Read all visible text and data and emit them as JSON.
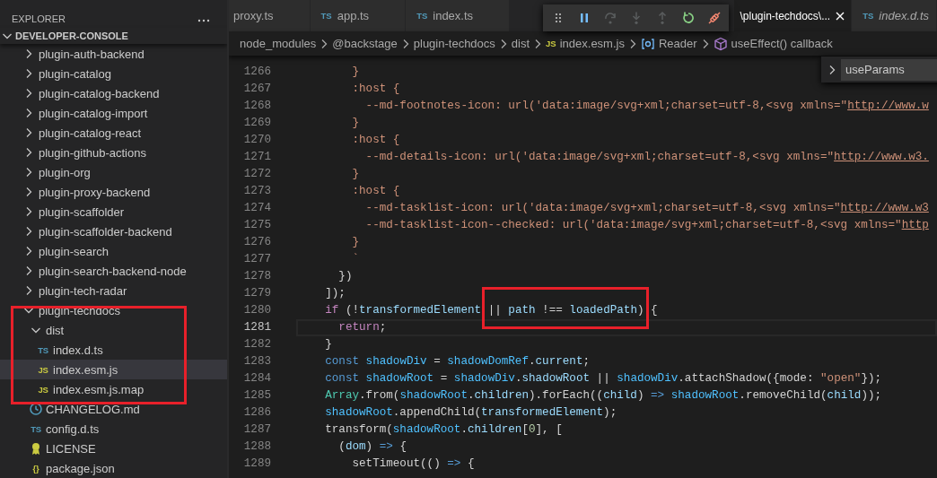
{
  "sidebar": {
    "title": "EXPLORER",
    "section": {
      "label": "DEVELOPER-CONSOLE",
      "expanded": true
    },
    "tree": [
      {
        "label": "plugin-auth-backend",
        "kind": "folder",
        "expanded": false,
        "selected": false
      },
      {
        "label": "plugin-catalog",
        "kind": "folder",
        "expanded": false,
        "selected": false
      },
      {
        "label": "plugin-catalog-backend",
        "kind": "folder",
        "expanded": false,
        "selected": false
      },
      {
        "label": "plugin-catalog-import",
        "kind": "folder",
        "expanded": false,
        "selected": false
      },
      {
        "label": "plugin-catalog-react",
        "kind": "folder",
        "expanded": false,
        "selected": false
      },
      {
        "label": "plugin-github-actions",
        "kind": "folder",
        "expanded": false,
        "selected": false
      },
      {
        "label": "plugin-org",
        "kind": "folder",
        "expanded": false,
        "selected": false
      },
      {
        "label": "plugin-proxy-backend",
        "kind": "folder",
        "expanded": false,
        "selected": false
      },
      {
        "label": "plugin-scaffolder",
        "kind": "folder",
        "expanded": false,
        "selected": false
      },
      {
        "label": "plugin-scaffolder-backend",
        "kind": "folder",
        "expanded": false,
        "selected": false
      },
      {
        "label": "plugin-search",
        "kind": "folder",
        "expanded": false,
        "selected": false
      },
      {
        "label": "plugin-search-backend-node",
        "kind": "folder",
        "expanded": false,
        "selected": false
      },
      {
        "label": "plugin-tech-radar",
        "kind": "folder",
        "expanded": false,
        "selected": false
      },
      {
        "label": "plugin-techdocs",
        "kind": "folder",
        "expanded": true,
        "selected": false,
        "children": [
          {
            "label": "dist",
            "kind": "folder",
            "expanded": true,
            "selected": false,
            "children": [
              {
                "label": "index.d.ts",
                "kind": "ts",
                "badge": "TS",
                "selected": false
              },
              {
                "label": "index.esm.js",
                "kind": "js",
                "badge": "JS",
                "selected": true
              },
              {
                "label": "index.esm.js.map",
                "kind": "js",
                "badge": "JS",
                "selected": false
              }
            ]
          },
          {
            "label": "CHANGELOG.md",
            "kind": "md",
            "selected": false
          },
          {
            "label": "config.d.ts",
            "kind": "ts",
            "badge": "TS",
            "selected": false
          },
          {
            "label": "LICENSE",
            "kind": "license",
            "selected": false
          },
          {
            "label": "package.json",
            "kind": "json",
            "badge": "{}",
            "selected": false
          }
        ]
      }
    ]
  },
  "editor": {
    "tabs": [
      {
        "label": "proxy.ts",
        "selected": false,
        "preview": false
      },
      {
        "label": "app.ts",
        "badge": "TS",
        "selected": false,
        "preview": false
      },
      {
        "label": "index.ts",
        "badge": "TS",
        "selected": false,
        "preview": false
      },
      {
        "label": "\\plugin-techdocs\\...",
        "selected": true,
        "preview": false
      },
      {
        "label": "index.d.ts",
        "badge": "TS",
        "selected": false,
        "preview": true
      }
    ],
    "debug_toolbar": [
      {
        "kind": "grip",
        "disabled": false
      },
      {
        "kind": "pause",
        "disabled": false
      },
      {
        "kind": "step-over",
        "disabled": true
      },
      {
        "kind": "step-into",
        "disabled": true
      },
      {
        "kind": "step-out",
        "disabled": true
      },
      {
        "kind": "restart",
        "disabled": false
      },
      {
        "kind": "disconnect",
        "disabled": false
      }
    ],
    "breadcrumb": [
      {
        "label": "node_modules",
        "kind": "folder"
      },
      {
        "label": "@backstage",
        "kind": "folder"
      },
      {
        "label": "plugin-techdocs",
        "kind": "folder"
      },
      {
        "label": "dist",
        "kind": "folder"
      },
      {
        "label": "index.esm.js",
        "kind": "js",
        "badge": "JS"
      },
      {
        "label": "Reader",
        "kind": "variable"
      },
      {
        "label": "useEffect() callback",
        "kind": "method"
      }
    ],
    "find_widget": {
      "expanded": false,
      "value": "useParams"
    },
    "lines": [
      {
        "number": "1266",
        "current": false,
        "tokens": [
          {
            "text": "        }",
            "kind": "str"
          }
        ]
      },
      {
        "number": "1267",
        "current": false,
        "tokens": [
          {
            "text": "        :host {",
            "kind": "str"
          }
        ]
      },
      {
        "number": "1268",
        "current": false,
        "tokens": [
          {
            "text": "          --md-footnotes-icon: url('data:image/svg+xml;charset=utf-8,<svg xmlns=\"",
            "kind": "str"
          },
          {
            "text": "http://www.w",
            "kind": "link"
          }
        ]
      },
      {
        "number": "1269",
        "current": false,
        "tokens": [
          {
            "text": "        }",
            "kind": "str"
          }
        ]
      },
      {
        "number": "1270",
        "current": false,
        "tokens": [
          {
            "text": "        :host {",
            "kind": "str"
          }
        ]
      },
      {
        "number": "1271",
        "current": false,
        "tokens": [
          {
            "text": "          --md-details-icon: url('data:image/svg+xml;charset=utf-8,<svg xmlns=\"",
            "kind": "str"
          },
          {
            "text": "http://www.w3.",
            "kind": "link"
          }
        ]
      },
      {
        "number": "1272",
        "current": false,
        "tokens": [
          {
            "text": "        }",
            "kind": "str"
          }
        ]
      },
      {
        "number": "1273",
        "current": false,
        "tokens": [
          {
            "text": "        :host {",
            "kind": "str"
          }
        ]
      },
      {
        "number": "1274",
        "current": false,
        "tokens": [
          {
            "text": "          --md-tasklist-icon: url('data:image/svg+xml;charset=utf-8,<svg xmlns=\"",
            "kind": "str"
          },
          {
            "text": "http://www.w3",
            "kind": "link"
          }
        ]
      },
      {
        "number": "1275",
        "current": false,
        "tokens": [
          {
            "text": "          --md-tasklist-icon--checked: url('data:image/svg+xml;charset=utf-8,<svg xmlns=\"",
            "kind": "str"
          },
          {
            "text": "http",
            "kind": "link"
          }
        ]
      },
      {
        "number": "1276",
        "current": false,
        "tokens": [
          {
            "text": "        }",
            "kind": "str"
          }
        ]
      },
      {
        "number": "1277",
        "current": false,
        "tokens": [
          {
            "text": "        `",
            "kind": "str"
          }
        ]
      },
      {
        "number": "1278",
        "current": false,
        "tokens": [
          {
            "text": "      })",
            "kind": "plain"
          }
        ]
      },
      {
        "number": "1279",
        "current": false,
        "tokens": [
          {
            "text": "    ]);",
            "kind": "plain"
          }
        ]
      },
      {
        "number": "1280",
        "current": false,
        "tokens": [
          {
            "text": "    if",
            "kind": "ctrl"
          },
          {
            "text": " (!",
            "kind": "plain"
          },
          {
            "text": "transformedElement",
            "kind": "var"
          },
          {
            "text": " || ",
            "kind": "plain"
          },
          {
            "text": "path",
            "kind": "var"
          },
          {
            "text": " !== ",
            "kind": "plain"
          },
          {
            "text": "loadedPath",
            "kind": "var"
          },
          {
            "text": ") {",
            "kind": "plain"
          }
        ]
      },
      {
        "number": "1281",
        "current": true,
        "tokens": [
          {
            "text": "      return",
            "kind": "ctrl"
          },
          {
            "text": ";",
            "kind": "plain"
          }
        ]
      },
      {
        "number": "1282",
        "current": false,
        "tokens": [
          {
            "text": "    }",
            "kind": "plain"
          }
        ]
      },
      {
        "number": "1283",
        "current": false,
        "tokens": [
          {
            "text": "    const",
            "kind": "kw"
          },
          {
            "text": " shadowDiv",
            "kind": "const"
          },
          {
            "text": " = ",
            "kind": "plain"
          },
          {
            "text": "shadowDomRef",
            "kind": "const"
          },
          {
            "text": ".",
            "kind": "plain"
          },
          {
            "text": "current",
            "kind": "var"
          },
          {
            "text": ";",
            "kind": "plain"
          }
        ]
      },
      {
        "number": "1284",
        "current": false,
        "tokens": [
          {
            "text": "    const",
            "kind": "kw"
          },
          {
            "text": " shadowRoot",
            "kind": "const"
          },
          {
            "text": " = ",
            "kind": "plain"
          },
          {
            "text": "shadowDiv",
            "kind": "const"
          },
          {
            "text": ".",
            "kind": "plain"
          },
          {
            "text": "shadowRoot",
            "kind": "var"
          },
          {
            "text": " || ",
            "kind": "plain"
          },
          {
            "text": "shadowDiv",
            "kind": "const"
          },
          {
            "text": ".attachShadow({mode: ",
            "kind": "plain"
          },
          {
            "text": "\"open\"",
            "kind": "str"
          },
          {
            "text": "});",
            "kind": "plain"
          }
        ]
      },
      {
        "number": "1285",
        "current": false,
        "tokens": [
          {
            "text": "    Array",
            "kind": "type"
          },
          {
            "text": ".from(",
            "kind": "plain"
          },
          {
            "text": "shadowRoot",
            "kind": "const"
          },
          {
            "text": ".",
            "kind": "plain"
          },
          {
            "text": "children",
            "kind": "var"
          },
          {
            "text": ").forEach((",
            "kind": "plain"
          },
          {
            "text": "child",
            "kind": "var"
          },
          {
            "text": ") ",
            "kind": "plain"
          },
          {
            "text": "=>",
            "kind": "kw"
          },
          {
            "text": " shadowRoot",
            "kind": "const"
          },
          {
            "text": ".removeChild(",
            "kind": "plain"
          },
          {
            "text": "child",
            "kind": "var"
          },
          {
            "text": "));",
            "kind": "plain"
          }
        ]
      },
      {
        "number": "1286",
        "current": false,
        "tokens": [
          {
            "text": "    shadowRoot",
            "kind": "const"
          },
          {
            "text": ".appendChild(",
            "kind": "plain"
          },
          {
            "text": "transformedElement",
            "kind": "var"
          },
          {
            "text": ");",
            "kind": "plain"
          }
        ]
      },
      {
        "number": "1287",
        "current": false,
        "tokens": [
          {
            "text": "    transform(",
            "kind": "plain"
          },
          {
            "text": "shadowRoot",
            "kind": "const"
          },
          {
            "text": ".",
            "kind": "plain"
          },
          {
            "text": "children",
            "kind": "var"
          },
          {
            "text": "[",
            "kind": "plain"
          },
          {
            "text": "0",
            "kind": "num"
          },
          {
            "text": "], [",
            "kind": "plain"
          }
        ]
      },
      {
        "number": "1288",
        "current": false,
        "tokens": [
          {
            "text": "      (",
            "kind": "plain"
          },
          {
            "text": "dom",
            "kind": "var"
          },
          {
            "text": ") ",
            "kind": "plain"
          },
          {
            "text": "=>",
            "kind": "kw"
          },
          {
            "text": " {",
            "kind": "plain"
          }
        ]
      },
      {
        "number": "1289",
        "current": false,
        "tokens": [
          {
            "text": "        setTimeout(() ",
            "kind": "plain"
          },
          {
            "text": "=>",
            "kind": "kw"
          },
          {
            "text": " {",
            "kind": "plain"
          }
        ]
      }
    ]
  }
}
